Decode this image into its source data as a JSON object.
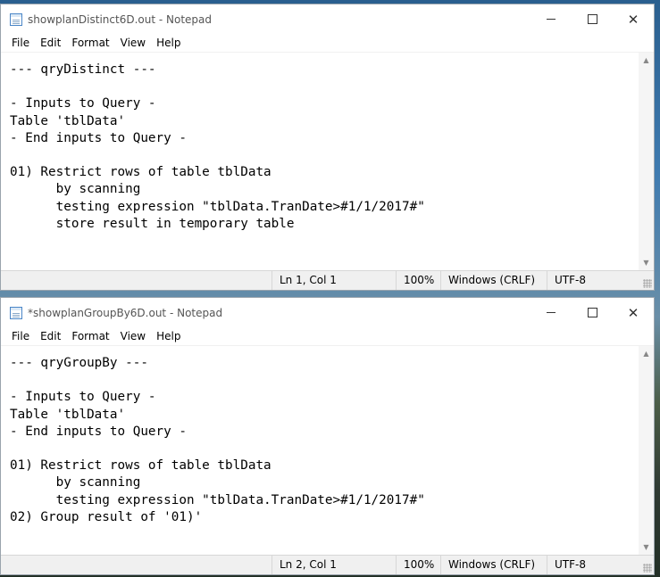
{
  "windows": [
    {
      "title": "showplanDistinct6D.out - Notepad",
      "menu": [
        "File",
        "Edit",
        "Format",
        "View",
        "Help"
      ],
      "content": "--- qryDistinct ---\n\n- Inputs to Query -\nTable 'tblData'\n- End inputs to Query -\n\n01) Restrict rows of table tblData\n      by scanning\n      testing expression \"tblData.TranDate>#1/1/2017#\"\n      store result in temporary table",
      "status": {
        "position": "Ln 1, Col 1",
        "zoom": "100%",
        "line_ending": "Windows (CRLF)",
        "encoding": "UTF-8"
      }
    },
    {
      "title": "*showplanGroupBy6D.out - Notepad",
      "menu": [
        "File",
        "Edit",
        "Format",
        "View",
        "Help"
      ],
      "content": "--- qryGroupBy ---\n\n- Inputs to Query -\nTable 'tblData'\n- End inputs to Query -\n\n01) Restrict rows of table tblData\n      by scanning\n      testing expression \"tblData.TranDate>#1/1/2017#\"\n02) Group result of '01)'",
      "status": {
        "position": "Ln 2, Col 1",
        "zoom": "100%",
        "line_ending": "Windows (CRLF)",
        "encoding": "UTF-8"
      }
    }
  ],
  "icons": {
    "app": "notepad-icon",
    "minimize": "minimize-icon",
    "maximize": "maximize-icon",
    "close": "close-icon",
    "scroll_up": "chevron-up-icon",
    "scroll_down": "chevron-down-icon"
  },
  "glyphs": {
    "close": "✕",
    "up": "▲",
    "down": "▼"
  }
}
